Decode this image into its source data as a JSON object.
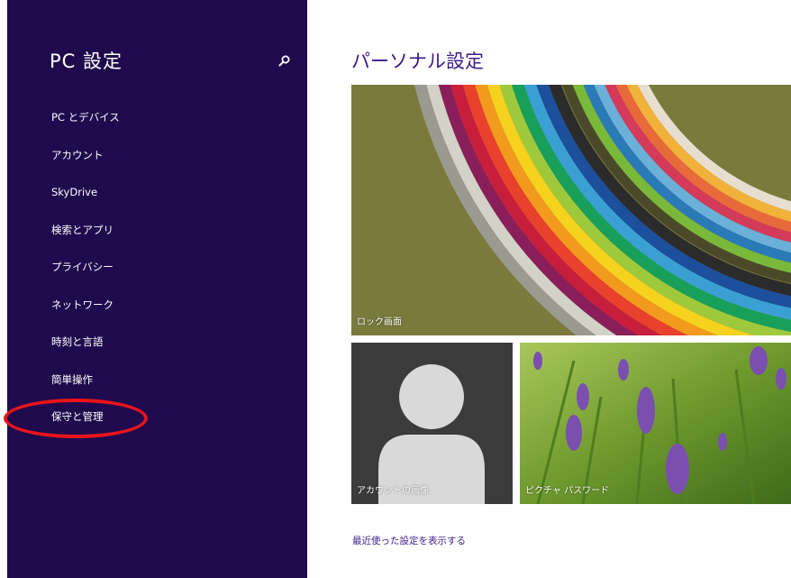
{
  "sidebar": {
    "title": "PC 設定",
    "search_icon": "search-icon",
    "items": [
      {
        "label": "PC とデバイス"
      },
      {
        "label": "アカウント"
      },
      {
        "label": "SkyDrive"
      },
      {
        "label": "検索とアプリ"
      },
      {
        "label": "プライバシー"
      },
      {
        "label": "ネットワーク"
      },
      {
        "label": "時刻と言語"
      },
      {
        "label": "簡単操作"
      },
      {
        "label": "保守と管理"
      }
    ],
    "highlighted_item": "保守と管理"
  },
  "main": {
    "title": "パーソナル設定",
    "tiles": {
      "lock_screen": {
        "label": "ロック画面"
      },
      "account_picture": {
        "label": "アカウントの画像"
      },
      "picture_password": {
        "label": "ピクチャ パスワード"
      }
    },
    "recent_link": "最近使った設定を表示する"
  },
  "colors": {
    "sidebar_bg": "#1f0a4d",
    "accent": "#3f1c8a",
    "highlight_ring": "#e8141b"
  }
}
